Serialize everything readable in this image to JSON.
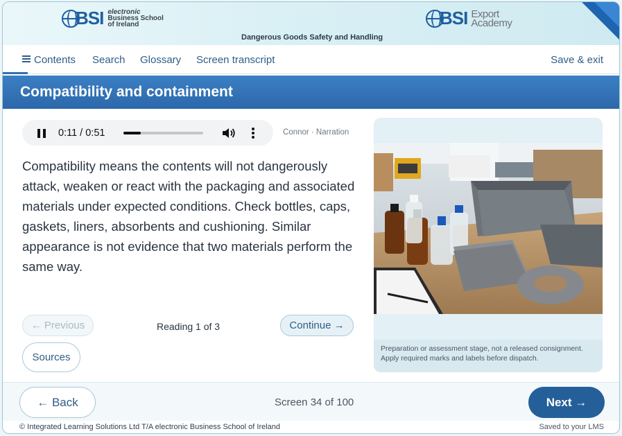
{
  "header": {
    "left_logo": {
      "mark": "BSI",
      "lines": [
        "electronic",
        "Business School",
        "of Ireland"
      ]
    },
    "right_logo": {
      "mark": "BSI",
      "lines": [
        "Export",
        "Academy"
      ]
    },
    "course_title": "Dangerous Goods Safety and Handling",
    "accent_color": "#1f64b0"
  },
  "nav": {
    "contents": "Contents",
    "search": "Search",
    "glossary": "Glossary",
    "transcript": "Screen transcript",
    "save_exit": "Save & exit"
  },
  "page": {
    "title": "Compatibility and containment",
    "title_bar_color": "#2c68aa"
  },
  "audio": {
    "time": "0:11 / 0:51",
    "progress": 0.22,
    "narrator": "Connor · Narration"
  },
  "body": {
    "text": "Compatibility means the contents will not dangerously attack, weaken or react with the packaging and associated materials under expected conditions. Check bottles, caps, gaskets, liners, absorbents and cushioning. Similar appearance is not evidence that two materials perform the same way."
  },
  "reading": {
    "previous": "← Previous",
    "status": "Reading 1 of 3",
    "continue": "Continue →",
    "sources": "Sources"
  },
  "image": {
    "caption_line1": "Preparation or assessment stage, not a released consignment.",
    "caption_line2": "Apply required marks and labels before dispatch."
  },
  "footer": {
    "back": "← Back",
    "screen": "Screen 34 of 100",
    "next": "Next →",
    "copyright": "© Integrated Learning Solutions Ltd T/A electronic Business School of Ireland",
    "saved": "Saved to your LMS"
  }
}
